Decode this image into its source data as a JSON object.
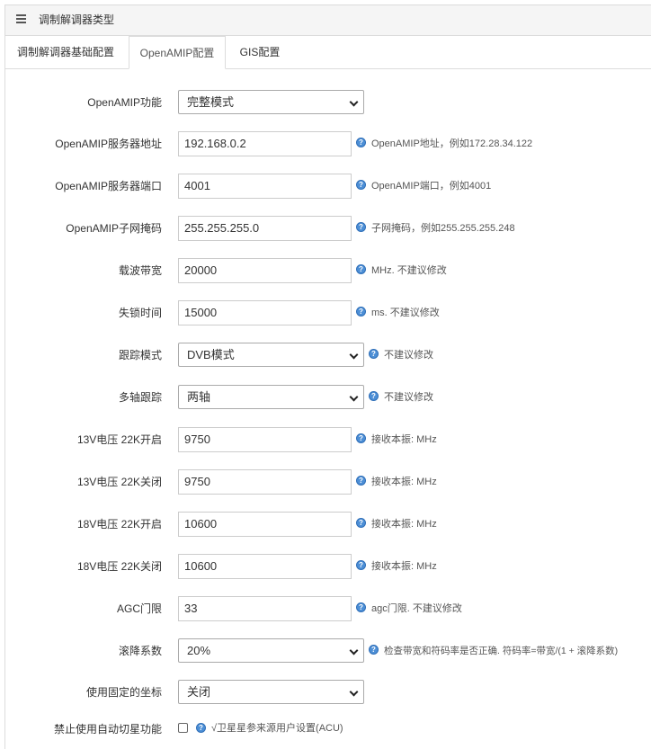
{
  "panel": {
    "title": "调制解调器类型"
  },
  "tabs": [
    {
      "label": "调制解调器基础配置"
    },
    {
      "label": "OpenAMIP配置"
    },
    {
      "label": "GIS配置"
    }
  ],
  "form": {
    "openamip_mode": {
      "label": "OpenAMIP功能",
      "value": "完整模式"
    },
    "server_ip": {
      "label": "OpenAMIP服务器地址",
      "value": "192.168.0.2",
      "hint": "OpenAMIP地址，例如172.28.34.122"
    },
    "server_port": {
      "label": "OpenAMIP服务器端口",
      "value": "4001",
      "hint": "OpenAMIP端口，例如4001"
    },
    "subnet_mask": {
      "label": "OpenAMIP子网掩码",
      "value": "255.255.255.0",
      "hint": "子网掩码，例如255.255.255.248"
    },
    "bandwidth": {
      "label": "载波带宽",
      "value": "20000",
      "hint": "MHz. 不建议修改"
    },
    "lock_time": {
      "label": "失锁时间",
      "value": "15000",
      "hint": "ms. 不建议修改"
    },
    "track_mode": {
      "label": "跟踪模式",
      "value": "DVB模式",
      "hint": "不建议修改"
    },
    "multi_axis": {
      "label": "多轴跟踪",
      "value": "两轴",
      "hint": "不建议修改"
    },
    "v13_22k_on": {
      "label": "13V电压 22K开启",
      "value": "9750",
      "hint": "接收本振: MHz"
    },
    "v13_22k_off": {
      "label": "13V电压 22K关闭",
      "value": "9750",
      "hint": "接收本振: MHz"
    },
    "v18_22k_on": {
      "label": "18V电压 22K开启",
      "value": "10600",
      "hint": "接收本振: MHz"
    },
    "v18_22k_off": {
      "label": "18V电压 22K关闭",
      "value": "10600",
      "hint": "接收本振: MHz"
    },
    "agc_threshold": {
      "label": "AGC门限",
      "value": "33",
      "hint": "agc门限. 不建议修改"
    },
    "rolloff": {
      "label": "滚降系数",
      "value": "20%",
      "hint": "检查带宽和符码率是否正确. 符码率=带宽/(1 + 滚降系数)"
    },
    "fixed_coords": {
      "label": "使用固定的坐标",
      "value": "关闭"
    },
    "disable_auto_switch": {
      "label": "禁止使用自动切星功能",
      "checked": false,
      "hint": "√卫星星参来源用户设置(ACU)"
    }
  },
  "icons": {
    "help_symbol": "?"
  }
}
